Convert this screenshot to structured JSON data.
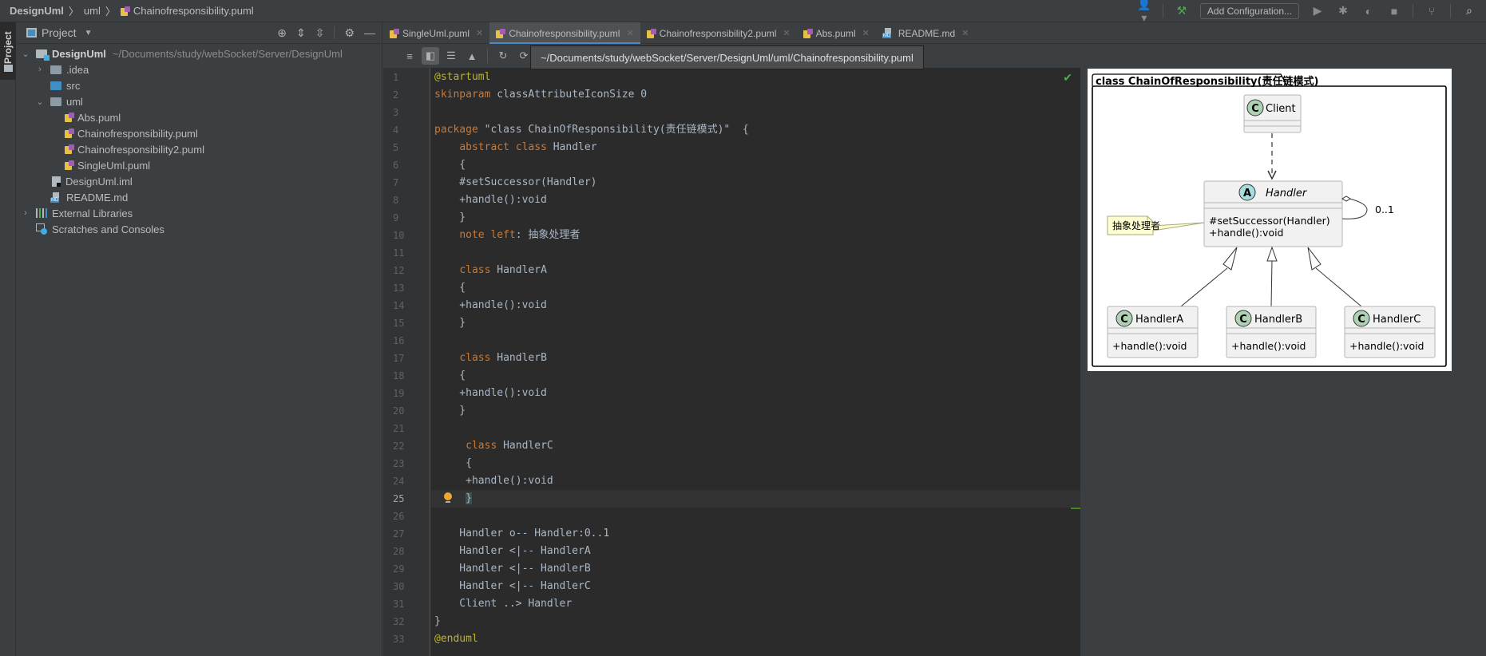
{
  "breadcrumb": {
    "project": "DesignUml",
    "folder": "uml",
    "file": "Chainofresponsibility.puml"
  },
  "toolbar": {
    "add_configuration_label": "Add Configuration...",
    "icons": [
      "user-icon",
      "build-hammer-icon",
      "run-icon",
      "debug-icon",
      "coverage-icon",
      "stop-icon",
      "git-icon",
      "search-icon"
    ]
  },
  "left_strip": {
    "project_tab_label": "Project"
  },
  "project_panel": {
    "title": "Project",
    "tree": [
      {
        "label": "DesignUml",
        "path": "~/Documents/study/webSocket/Server/DesignUml",
        "type": "root",
        "expanded": true,
        "depth": 0
      },
      {
        "label": ".idea",
        "type": "folder",
        "expanded": false,
        "depth": 1
      },
      {
        "label": "src",
        "type": "folder-source",
        "depth": 1
      },
      {
        "label": "uml",
        "type": "folder",
        "expanded": true,
        "depth": 1
      },
      {
        "label": "Abs.puml",
        "type": "puml",
        "depth": 2
      },
      {
        "label": "Chainofresponsibility.puml",
        "type": "puml",
        "depth": 2
      },
      {
        "label": "Chainofresponsibility2.puml",
        "type": "puml",
        "depth": 2
      },
      {
        "label": "SingleUml.puml",
        "type": "puml",
        "depth": 2
      },
      {
        "label": "DesignUml.iml",
        "type": "iml",
        "depth": 1
      },
      {
        "label": "README.md",
        "type": "md",
        "depth": 1
      },
      {
        "label": "External Libraries",
        "type": "libraries",
        "expanded": false,
        "depth": 0
      },
      {
        "label": "Scratches and Consoles",
        "type": "scratches",
        "depth": 0
      }
    ]
  },
  "tabs": [
    {
      "label": "SingleUml.puml",
      "active": false
    },
    {
      "label": "Chainofresponsibility.puml",
      "active": true
    },
    {
      "label": "Chainofresponsibility2.puml",
      "active": false
    },
    {
      "label": "Abs.puml",
      "active": false
    },
    {
      "label": "README.md",
      "active": false
    }
  ],
  "editor": {
    "path_tooltip": "~/Documents/study/webSocket/Server/DesignUml/uml/Chainofresponsibility.puml",
    "current_line": 25,
    "lines": [
      "@startuml",
      "skinparam classAttributeIconSize 0",
      "",
      "package \"class ChainOfResponsibility(责任链模式)\"  {",
      "    abstract class Handler",
      "    {",
      "    #setSuccessor(Handler)",
      "    +handle():void",
      "    }",
      "    note left: 抽象处理者",
      "",
      "    class HandlerA",
      "    {",
      "    +handle():void",
      "    }",
      "",
      "    class HandlerB",
      "    {",
      "    +handle():void",
      "    }",
      "",
      "     class HandlerC",
      "     {",
      "     +handle():void",
      "     }",
      "",
      "    Handler o-- Handler:0..1",
      "    Handler <|-- HandlerA",
      "    Handler <|-- HandlerB",
      "    Handler <|-- HandlerC",
      "    Client ..> Handler",
      "}",
      "@enduml"
    ]
  },
  "diagram": {
    "package_title": "class ChainOfResponsibility(责任链模式)",
    "client": {
      "name": "Client",
      "stereotype": "C"
    },
    "handler": {
      "name": "Handler",
      "stereotype": "A",
      "methods": [
        "#setSuccessor(Handler)",
        "+handle():void"
      ]
    },
    "note": "抽象处理者",
    "self_multiplicity": "0..1",
    "subclasses": [
      {
        "name": "HandlerA",
        "stereotype": "C",
        "methods": [
          "+handle():void"
        ]
      },
      {
        "name": "HandlerB",
        "stereotype": "C",
        "methods": [
          "+handle():void"
        ]
      },
      {
        "name": "HandlerC",
        "stereotype": "C",
        "methods": [
          "+handle():void"
        ]
      }
    ]
  }
}
